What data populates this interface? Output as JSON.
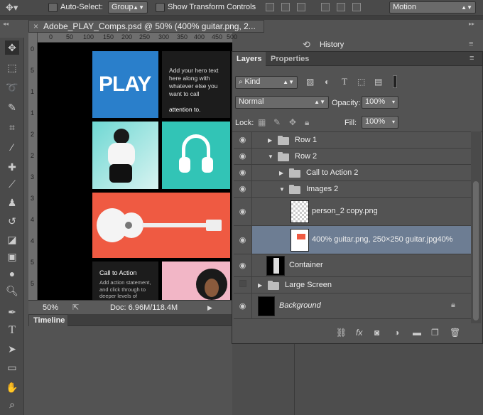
{
  "options_bar": {
    "auto_select_label": "Auto-Select:",
    "auto_select_value": "Group",
    "transform_label": "Show Transform Controls",
    "workspace_value": "Motion"
  },
  "document": {
    "tab_title": "Adobe_PLAY_Comps.psd @ 50% (400% guitar.png, 2...",
    "ruler_ticks_h": [
      "0",
      "50",
      "100",
      "150",
      "200",
      "250",
      "300",
      "350",
      "400",
      "450",
      "500"
    ],
    "ruler_ticks_v": [
      "0",
      "5",
      "1",
      "1",
      "2",
      "2",
      "3",
      "3",
      "4",
      "4",
      "5",
      "5"
    ],
    "status_zoom": "50%",
    "status_doc": "Doc: 6.96M/118.4M",
    "canvas": {
      "play_text": "PLAY",
      "hero_text_1": "Add your hero text here along with whatever else you want to call",
      "hero_text_2": "attention to.",
      "cta_title": "Call to Action",
      "cta_body": "Add action statement, and click through to deeper levels of content."
    }
  },
  "timeline": {
    "tab_label": "Timeline"
  },
  "history": {
    "label": "History"
  },
  "layers_panel": {
    "tabs": [
      "Layers",
      "Properties"
    ],
    "filter_value": "Kind",
    "blend_mode": "Normal",
    "opacity_label": "Opacity:",
    "opacity_value": "100%",
    "lock_label": "Lock:",
    "fill_label": "Fill:",
    "fill_value": "100%",
    "layers": [
      {
        "name": "Row 1"
      },
      {
        "name": "Row 2"
      },
      {
        "name": "Call to Action 2"
      },
      {
        "name": "Images 2"
      },
      {
        "name": "person_2 copy.png"
      },
      {
        "name": "400% guitar.png, 250×250 guitar.jpg40%"
      },
      {
        "name": "Container"
      },
      {
        "name": "Large Screen"
      },
      {
        "name": "Background"
      }
    ]
  },
  "colors": {
    "selected_row": "#6d7d93",
    "play_blue": "#2a7fcb",
    "teal": "#35c2b5",
    "coral": "#ef5a42"
  }
}
